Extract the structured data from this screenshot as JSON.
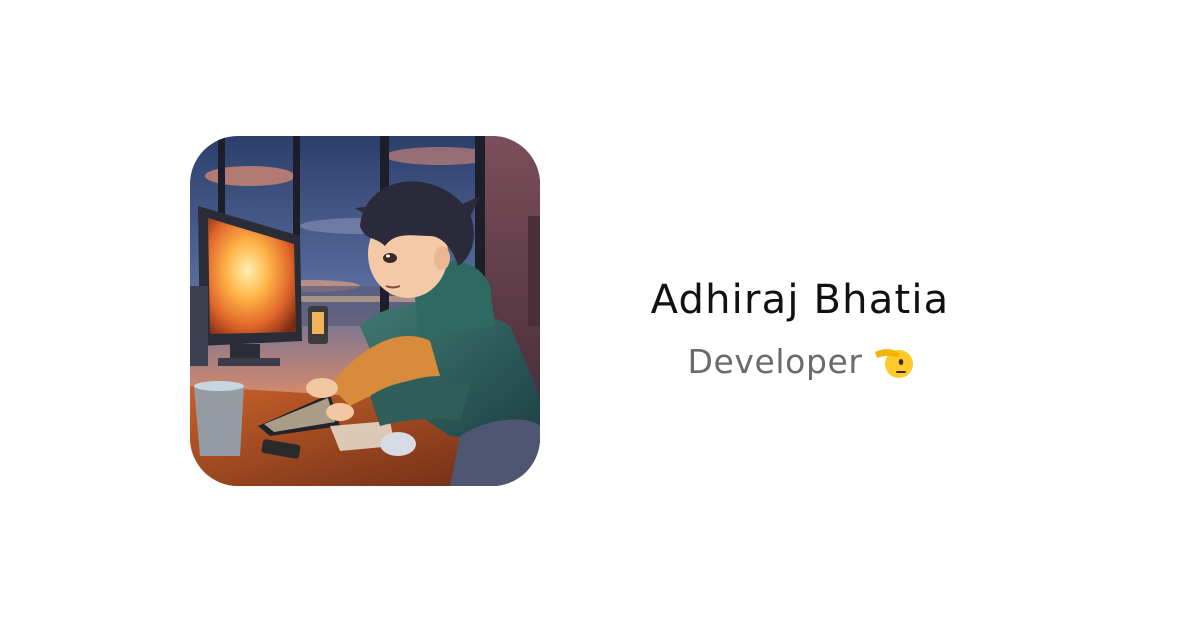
{
  "profile": {
    "name": "Adhiraj Bhatia",
    "role": "Developer",
    "role_emoji": "saluting-face-icon",
    "avatar_icon": "anime-developer-avatar-image"
  },
  "colors": {
    "background": "#ffffff",
    "name_text": "#111111",
    "role_text": "#6b6b6b"
  }
}
